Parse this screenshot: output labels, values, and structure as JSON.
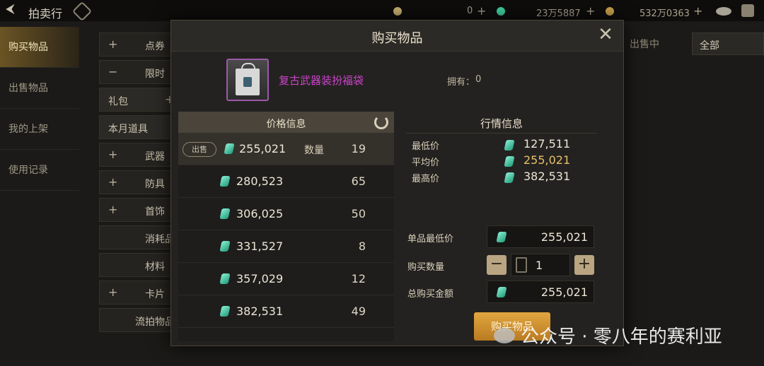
{
  "topbar": {
    "back_glyph": "⮜",
    "title": "拍卖行",
    "currencies": [
      {
        "value": "0",
        "plus": "+"
      },
      {
        "value": "23万5887",
        "plus": "+"
      },
      {
        "value": "532万0363",
        "plus": "+"
      }
    ]
  },
  "sidebar": {
    "items": [
      {
        "label": "购买物品"
      },
      {
        "label": "出售物品"
      },
      {
        "label": "我的上架"
      },
      {
        "label": "使用记录"
      }
    ]
  },
  "categories": [
    {
      "sign": "+",
      "label": "点券"
    },
    {
      "sign": "−",
      "label": "限时"
    },
    {
      "label": "礼包",
      "sign": "+"
    },
    {
      "label": "本月道具"
    },
    {
      "sign": "+",
      "label": "武器"
    },
    {
      "sign": "+",
      "label": "防具"
    },
    {
      "sign": "+",
      "label": "首饰"
    },
    {
      "label": "消耗品"
    },
    {
      "label": "材料"
    },
    {
      "sign": "+",
      "label": "卡片"
    },
    {
      "label": "流拍物品"
    }
  ],
  "right": {
    "tab": "出售中",
    "filter": "全部"
  },
  "modal": {
    "title": "购买物品",
    "close_glyph": "✕",
    "item_name": "复古武器装扮福袋",
    "owned_label": "拥有：",
    "owned_value": "0",
    "price_panel_title": "价格信息",
    "sell_badge": "出售",
    "qty_label": "数量",
    "listings": [
      {
        "price": "255,021",
        "qty": "19"
      },
      {
        "price": "280,523",
        "qty": "65"
      },
      {
        "price": "306,025",
        "qty": "50"
      },
      {
        "price": "331,527",
        "qty": "8"
      },
      {
        "price": "357,029",
        "qty": "12"
      },
      {
        "price": "382,531",
        "qty": "49"
      }
    ],
    "market_title": "行情信息",
    "market": [
      {
        "label": "最低价",
        "value": "127,511"
      },
      {
        "label": "平均价",
        "value": "255,021"
      },
      {
        "label": "最高价",
        "value": "382,531"
      }
    ],
    "unit_min_label": "单品最低价",
    "unit_min_value": "255,021",
    "buy_qty_label": "购买数量",
    "buy_qty_value": "1",
    "total_label": "总购买金额",
    "total_value": "255,021",
    "buy_button": "购买物品"
  },
  "watermark": {
    "text": "公众号 · 零八年的赛利亚"
  },
  "colors": {
    "gem": "#3fcf9f",
    "item_name": "#c943c9",
    "avg_price": "#e7c06a",
    "buy_button": "#d8952f"
  }
}
